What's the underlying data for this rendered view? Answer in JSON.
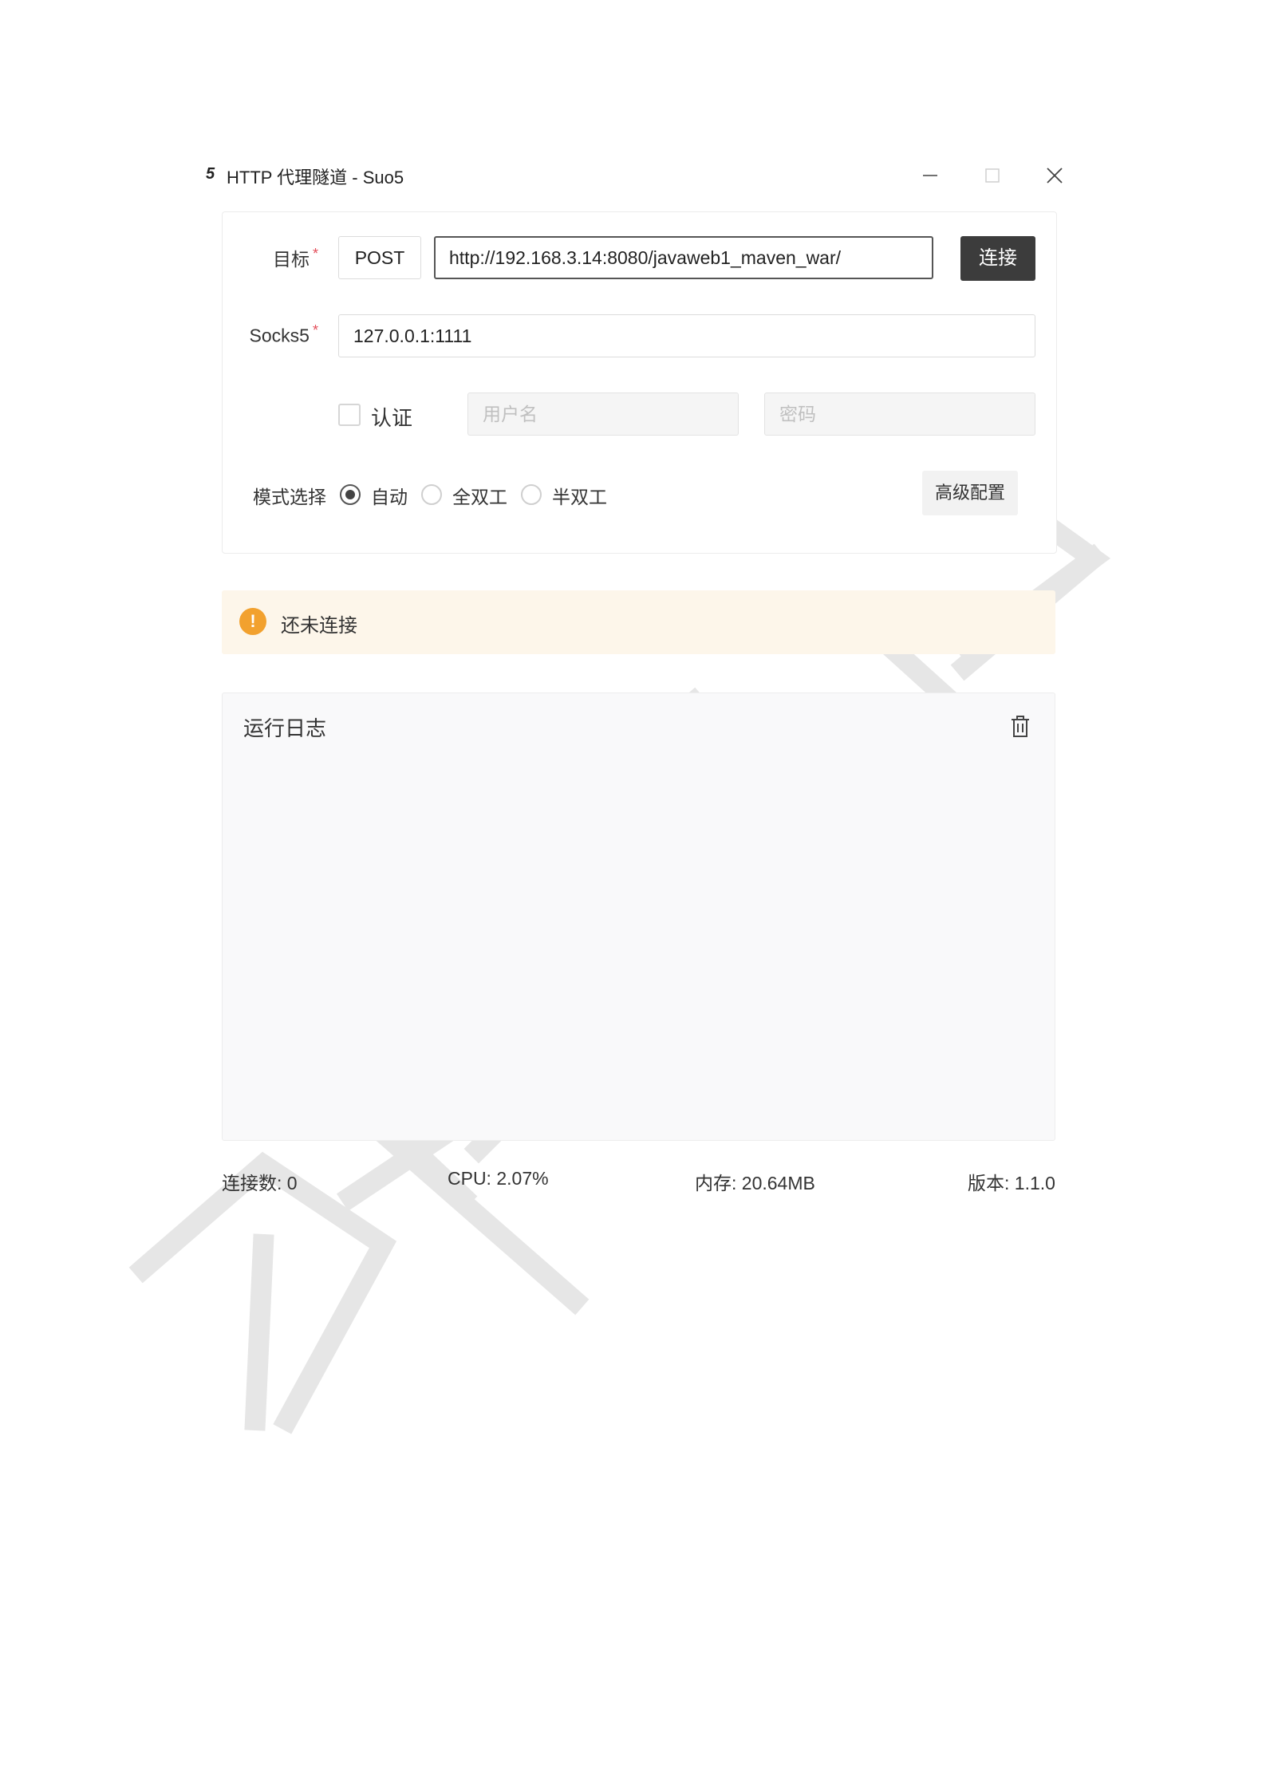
{
  "window": {
    "logo": "5",
    "title": "HTTP 代理隧道 - Suo5",
    "controls": {
      "minimize": "minimize-icon",
      "maximize": "maximize-icon",
      "close": "close-icon"
    }
  },
  "form": {
    "target_label": "目标",
    "required_mark": "*",
    "method": "POST",
    "url": "http://192.168.3.14:8080/javaweb1_maven_war/",
    "connect_label": "连接",
    "socks5_label": "Socks5",
    "socks5_value": "127.0.0.1:1111",
    "auth_label": "认证",
    "auth_checked": false,
    "username_placeholder": "用户名",
    "password_placeholder": "密码",
    "mode_label": "模式选择",
    "modes": [
      {
        "label": "自动",
        "selected": true
      },
      {
        "label": "全双工",
        "selected": false
      },
      {
        "label": "半双工",
        "selected": false
      }
    ],
    "advanced_label": "高级配置"
  },
  "status": {
    "text": "还未连接",
    "icon": "warning-icon",
    "color": "#f2a12e"
  },
  "log": {
    "title": "运行日志",
    "clear_icon": "trash-icon"
  },
  "footer": {
    "connections": "连接数: 0",
    "cpu": "CPU: 2.07%",
    "memory": "内存: 20.64MB",
    "version": "版本: 1.1.0"
  },
  "watermark": "及辞要学习"
}
